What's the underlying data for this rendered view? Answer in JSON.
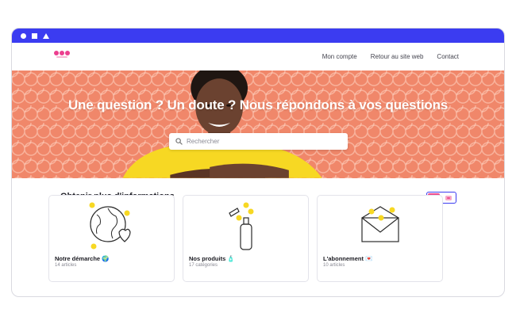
{
  "nav": {
    "links": [
      "Mon compte",
      "Retour au site web",
      "Contact"
    ]
  },
  "hero": {
    "title": "Une question ? Un doute ? Nous répondons à vos questions",
    "search_placeholder": "Rechercher"
  },
  "section": {
    "title": "Obtenir plus d'informations"
  },
  "cards": [
    {
      "title": "Notre démarche 🌍",
      "subtitle": "14 articles",
      "icon": "globe-heart-icon"
    },
    {
      "title": "Nos produits 🧴",
      "subtitle": "17 catégories",
      "icon": "spray-bottle-icon"
    },
    {
      "title": "L'abonnement 💌",
      "subtitle": "10 articles",
      "icon": "envelope-icon"
    }
  ],
  "colors": {
    "titlebar": "#3b3cf1",
    "brand_pink": "#ec3f8f",
    "hero_bg": "#f0876a",
    "accent_yellow": "#f7d823"
  }
}
